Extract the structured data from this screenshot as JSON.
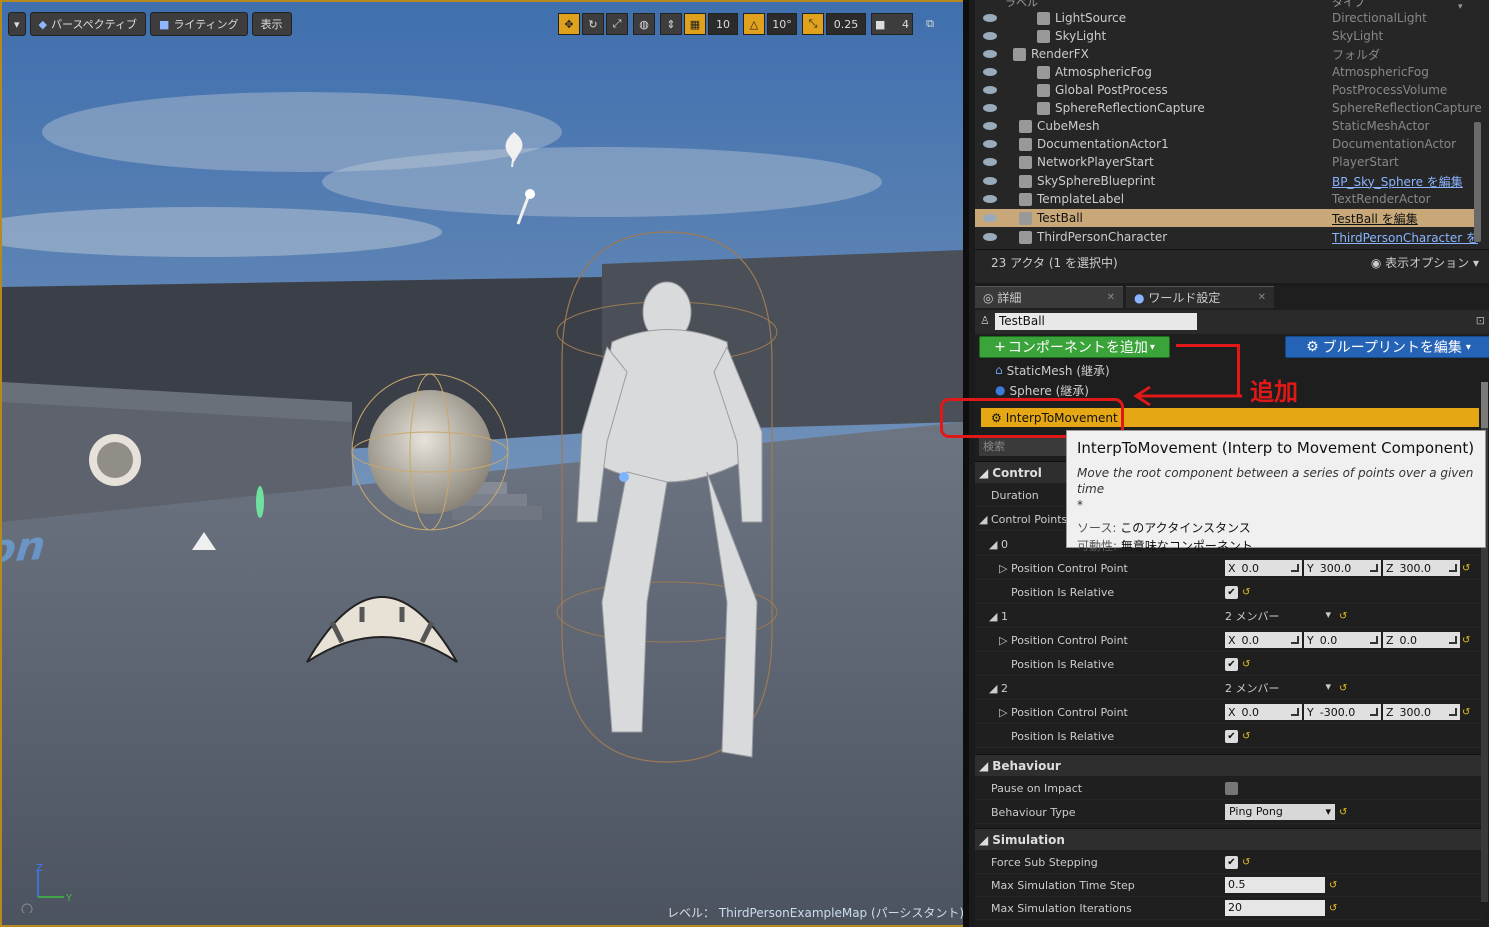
{
  "viewport": {
    "toolbar": {
      "perspective": "パースペクティブ",
      "lighting": "ライティング",
      "show": "表示",
      "grid_snap": "10",
      "rot_snap": "10°",
      "scale_snap": "0.25",
      "cam_speed": "4"
    },
    "floor_text": "ird Person",
    "level_label": "レベル：",
    "level_name": "ThirdPersonExampleMap (パーシスタント)",
    "axis_z": "Z",
    "axis_y": "Y"
  },
  "outliner": {
    "header_left": "ラベル",
    "header_right": "タイプ",
    "rows": [
      {
        "name": "LightSource",
        "type": "DirectionalLight",
        "indent": 2
      },
      {
        "name": "SkyLight",
        "type": "SkyLight",
        "indent": 2
      },
      {
        "name": "RenderFX",
        "type": "フォルダ",
        "indent": 1
      },
      {
        "name": "AtmosphericFog",
        "type": "AtmosphericFog",
        "indent": 2
      },
      {
        "name": "Global PostProcess",
        "type": "PostProcessVolume",
        "indent": 2
      },
      {
        "name": "SphereReflectionCapture",
        "type": "SphereReflectionCapture",
        "indent": 2
      },
      {
        "name": "CubeMesh",
        "type": "StaticMeshActor",
        "indent": 1
      },
      {
        "name": "DocumentationActor1",
        "type": "DocumentationActor",
        "indent": 1
      },
      {
        "name": "NetworkPlayerStart",
        "type": "PlayerStart",
        "indent": 1
      },
      {
        "name": "SkySphereBlueprint",
        "type": "BP_Sky_Sphere を編集",
        "indent": 1,
        "link": true
      },
      {
        "name": "TemplateLabel",
        "type": "TextRenderActor",
        "indent": 1
      },
      {
        "name": "TestBall",
        "type": "TestBall を編集",
        "indent": 1,
        "link": true,
        "selected": true
      },
      {
        "name": "ThirdPersonCharacter",
        "type": "ThirdPersonCharacter を",
        "indent": 1,
        "link": true
      }
    ],
    "count": "23 アクタ (1 を選択中)",
    "view_options": "表示オプション"
  },
  "details": {
    "tab_details": "詳細",
    "tab_world": "ワールド設定",
    "actor_name": "TestBall",
    "add_component": "コンポーネントを追加",
    "edit_blueprint": "ブループリントを編集",
    "components": [
      "StaticMesh (継承)",
      "Sphere (継承)"
    ],
    "selected_component": "InterpToMovement",
    "annotation": "追加",
    "search_placeholder": "検索",
    "tooltip": {
      "title": "InterpToMovement (Interp to Movement Component)",
      "desc": "Move the root component between a series of points over a given time",
      "star": "*",
      "source_label": "ソース:",
      "source_value": "このアクタインスタンス",
      "mobility_label": "可動性:",
      "mobility_value": "無意味なコンポーネント"
    },
    "control": {
      "title": "Control",
      "duration": "Duration",
      "control_points": "Control Points",
      "points": [
        {
          "index": "0",
          "members": "",
          "x": "0.0",
          "y": "300.0",
          "z": "300.0"
        },
        {
          "index": "1",
          "members": "2 メンバー",
          "x": "0.0",
          "y": "0.0",
          "z": "0.0"
        },
        {
          "index": "2",
          "members": "2 メンバー",
          "x": "0.0",
          "y": "-300.0",
          "z": "300.0"
        }
      ],
      "pos_label": "Position Control Point",
      "rel_label": "Position Is Relative",
      "x": "X",
      "y": "Y",
      "z": "Z"
    },
    "behaviour": {
      "title": "Behaviour",
      "pause": "Pause on Impact",
      "type_label": "Behaviour Type",
      "type_value": "Ping Pong"
    },
    "simulation": {
      "title": "Simulation",
      "sub": "Force Sub Stepping",
      "step_label": "Max Simulation Time Step",
      "step_value": "0.5",
      "iter_label": "Max Simulation Iterations",
      "iter_value": "20"
    }
  }
}
